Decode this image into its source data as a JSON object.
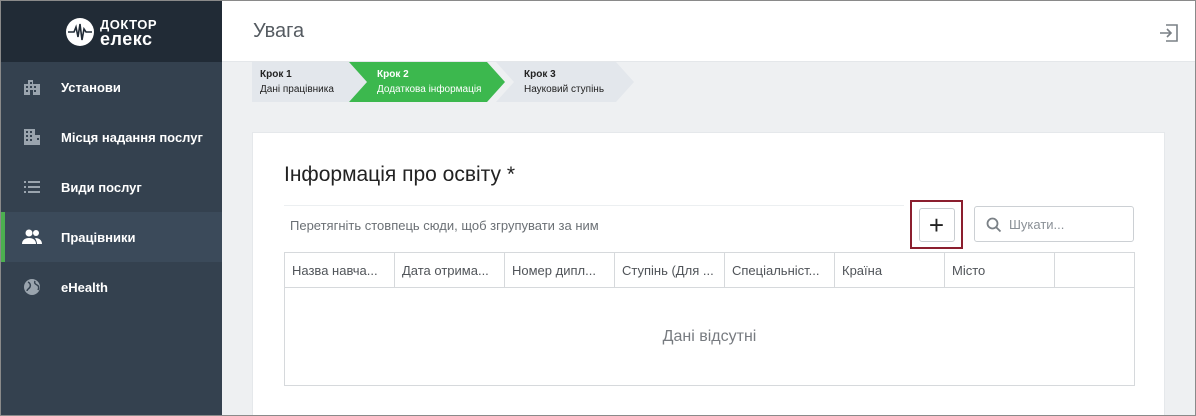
{
  "logo": {
    "line1": "ДОКТОР",
    "line2": "елекс"
  },
  "sidebar": {
    "items": [
      {
        "label": "Установи",
        "icon": "building-icon"
      },
      {
        "label": "Місця надання послуг",
        "icon": "office-building-icon"
      },
      {
        "label": "Види послуг",
        "icon": "list-icon"
      },
      {
        "label": "Працівники",
        "icon": "people-icon",
        "active": true
      },
      {
        "label": "eHealth",
        "icon": "globe-icon"
      }
    ]
  },
  "header": {
    "title": "Увага",
    "logout_icon": "logout-icon"
  },
  "wizard": {
    "steps": [
      {
        "num": "Крок 1",
        "label": "Дані працівника",
        "state": "done"
      },
      {
        "num": "Крок 2",
        "label": "Додаткова інформація",
        "state": "active"
      },
      {
        "num": "Крок 3",
        "label": "Науковий ступінь",
        "state": "pending"
      }
    ]
  },
  "section": {
    "title": "Інформація про освіту *",
    "group_hint": "Перетягніть стовпець сюди, щоб згрупувати за ним",
    "add_label": "+",
    "search_placeholder": "Шукати..."
  },
  "table": {
    "columns": [
      "Назва навча...",
      "Дата отрима...",
      "Номер дипл...",
      "Ступінь (Для ...",
      "Спеціальніст...",
      "Країна",
      "Місто",
      ""
    ],
    "empty_text": "Дані відсутні"
  },
  "colors": {
    "sidebar_bg": "#34414f",
    "logo_bg": "#212b36",
    "active_accent": "#4caf50",
    "step_done": "#e3e7ec",
    "step_active": "#3cb84e",
    "highlight_border": "#8b1e2e"
  }
}
